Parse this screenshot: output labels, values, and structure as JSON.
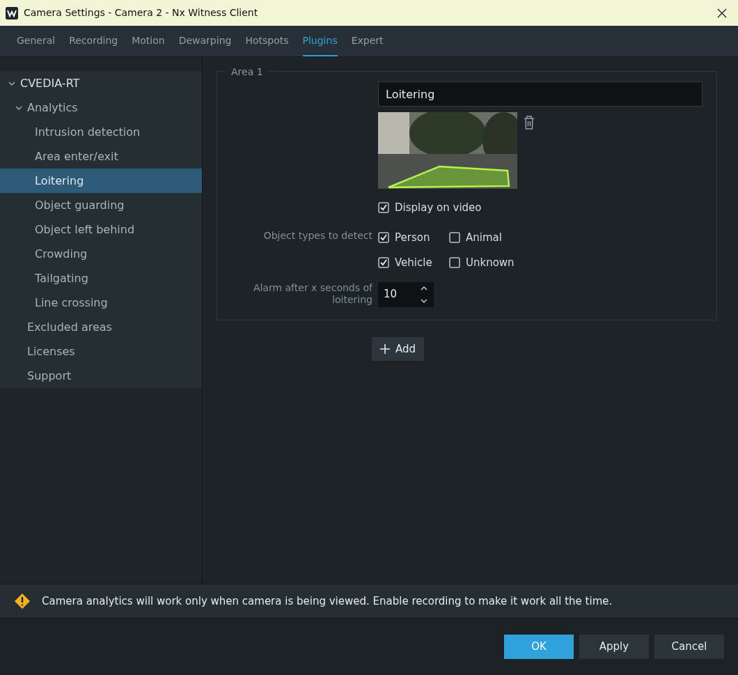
{
  "window": {
    "title": "Camera Settings - Camera 2 - Nx Witness Client"
  },
  "tabs": [
    {
      "label": "General",
      "selected": false
    },
    {
      "label": "Recording",
      "selected": false
    },
    {
      "label": "Motion",
      "selected": false
    },
    {
      "label": "Dewarping",
      "selected": false
    },
    {
      "label": "Hotspots",
      "selected": false
    },
    {
      "label": "Plugins",
      "selected": true
    },
    {
      "label": "Expert",
      "selected": false
    }
  ],
  "sidebar": {
    "items": [
      {
        "label": "CVEDIA-RT",
        "expanded": true,
        "selected": false,
        "children": [
          {
            "label": "Analytics",
            "expanded": true,
            "selected": false,
            "children": [
              {
                "label": "Intrusion detection",
                "selected": false
              },
              {
                "label": "Area enter/exit",
                "selected": false
              },
              {
                "label": "Loitering",
                "selected": true
              },
              {
                "label": "Object guarding",
                "selected": false
              },
              {
                "label": "Object left behind",
                "selected": false
              },
              {
                "label": "Crowding",
                "selected": false
              },
              {
                "label": "Tailgating",
                "selected": false
              },
              {
                "label": "Line crossing",
                "selected": false
              }
            ]
          },
          {
            "label": "Excluded areas",
            "selected": false
          },
          {
            "label": "Licenses",
            "selected": false
          },
          {
            "label": "Support",
            "selected": false
          }
        ]
      }
    ]
  },
  "area": {
    "title": "Area 1",
    "name": "Loitering",
    "display_on_video": {
      "label": "Display on video",
      "checked": true
    },
    "object_types": {
      "label": "Object types to detect",
      "options": [
        {
          "label": "Person",
          "checked": true
        },
        {
          "label": "Animal",
          "checked": false
        },
        {
          "label": "Vehicle",
          "checked": true
        },
        {
          "label": "Unknown",
          "checked": false
        }
      ]
    },
    "alarm": {
      "label": "Alarm after x seconds of loitering",
      "value": "10"
    }
  },
  "add_button": {
    "label": "Add"
  },
  "warning": {
    "text": "Camera analytics will work only when camera is being viewed. Enable recording to make it work all the time."
  },
  "buttons": [
    {
      "label": "OK",
      "kind": "primary"
    },
    {
      "label": "Apply",
      "kind": "secondary"
    },
    {
      "label": "Cancel",
      "kind": "secondary"
    }
  ]
}
